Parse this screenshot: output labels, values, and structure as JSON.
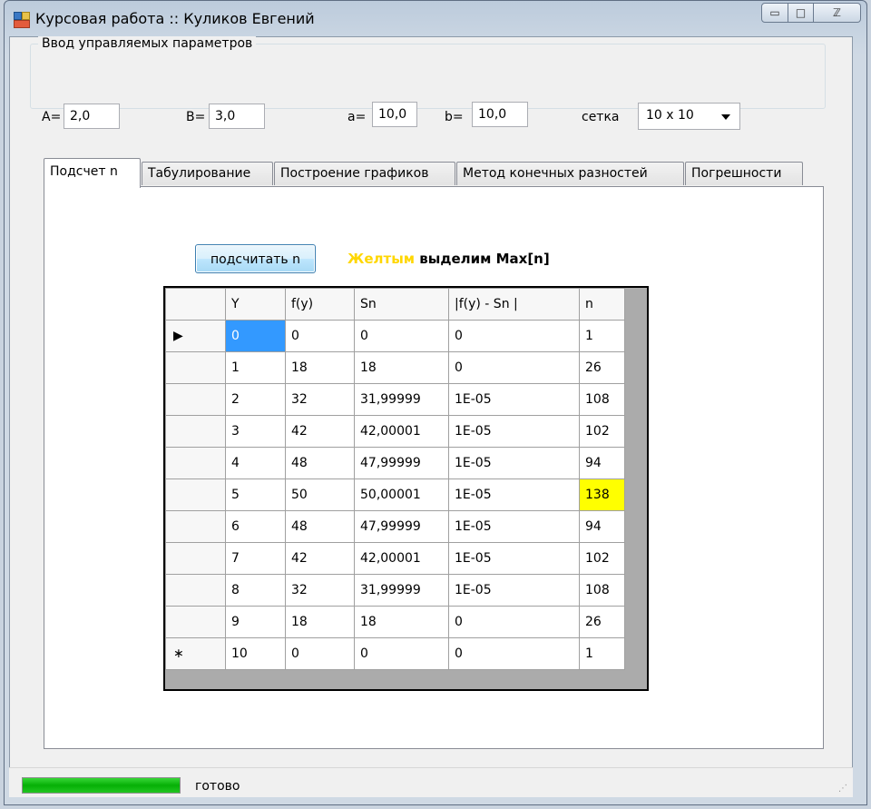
{
  "window": {
    "title": "Курсовая работа :: Куликов Евгений",
    "minimize_glyph": "▭",
    "maximize_glyph": "□",
    "close_glyph": "ℤ"
  },
  "params": {
    "group_title": "Ввод управляемых параметров",
    "A_label": "А=",
    "A_value": "2,0",
    "B_label": "В=",
    "B_value": "3,0",
    "a_label": "a=",
    "a_value": "10,0",
    "b_label": "b=",
    "b_value": "10,0",
    "grid_label": "сетка",
    "grid_value": "10 x 10"
  },
  "tabs": [
    {
      "label": "Подсчет n",
      "active": true
    },
    {
      "label": "Табулирование",
      "active": false
    },
    {
      "label": "Построение графиков",
      "active": false
    },
    {
      "label": "Метод конечных разностей",
      "active": false
    },
    {
      "label": "Погрешности",
      "active": false
    }
  ],
  "compute_button": "подсчитать n",
  "hint": {
    "yellow_word": "Желтым",
    "rest": "выделим Max[n]"
  },
  "table": {
    "columns": [
      "Y",
      "f(y)",
      "Sn",
      "|f(y) - Sn |",
      "n"
    ],
    "rows": [
      {
        "marker": "▶",
        "cells": [
          "0",
          "0",
          "0",
          "0",
          "1"
        ]
      },
      {
        "marker": "",
        "cells": [
          "1",
          "18",
          "18",
          "0",
          "26"
        ]
      },
      {
        "marker": "",
        "cells": [
          "2",
          "32",
          "31,99999",
          "1E-05",
          "108"
        ]
      },
      {
        "marker": "",
        "cells": [
          "3",
          "42",
          "42,00001",
          "1E-05",
          "102"
        ]
      },
      {
        "marker": "",
        "cells": [
          "4",
          "48",
          "47,99999",
          "1E-05",
          "94"
        ]
      },
      {
        "marker": "",
        "cells": [
          "5",
          "50",
          "50,00001",
          "1E-05",
          "138"
        ]
      },
      {
        "marker": "",
        "cells": [
          "6",
          "48",
          "47,99999",
          "1E-05",
          "94"
        ]
      },
      {
        "marker": "",
        "cells": [
          "7",
          "42",
          "42,00001",
          "1E-05",
          "102"
        ]
      },
      {
        "marker": "",
        "cells": [
          "8",
          "32",
          "31,99999",
          "1E-05",
          "108"
        ]
      },
      {
        "marker": "",
        "cells": [
          "9",
          "18",
          "18",
          "0",
          "26"
        ]
      },
      {
        "marker": "∗",
        "cells": [
          "10",
          "0",
          "0",
          "0",
          "1"
        ]
      }
    ],
    "highlight_color": "#ffff00",
    "selection_color": "#3399ff"
  },
  "status": {
    "text": "готово",
    "progress": 1.0
  }
}
